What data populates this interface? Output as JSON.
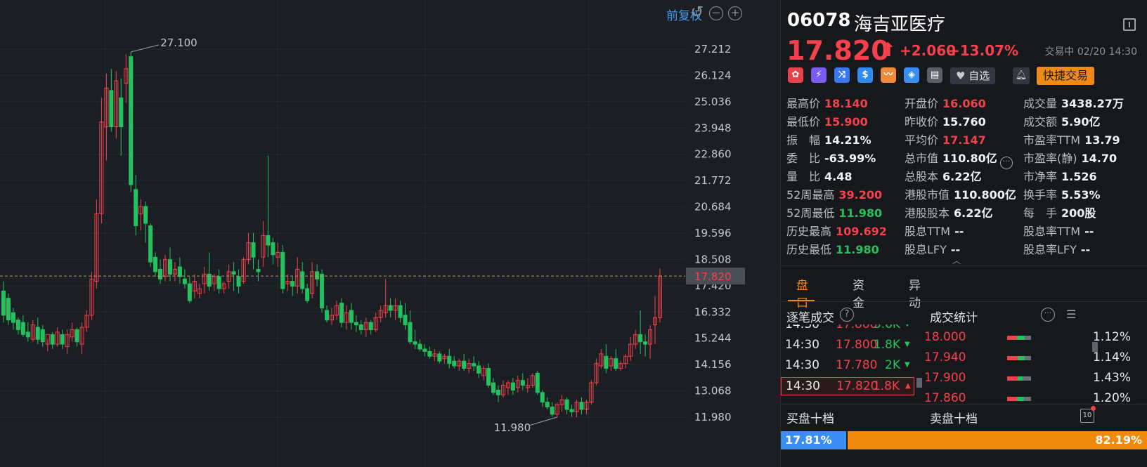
{
  "chart_toolbar": {
    "restore_label": "前复权",
    "reset_icon": "reset-icon",
    "zoom_out_icon": "zoom-out-icon",
    "zoom_in_icon": "zoom-in-icon"
  },
  "chart_data": {
    "type": "candlestick",
    "y_ticks": [
      "27.212",
      "26.124",
      "25.036",
      "23.948",
      "22.860",
      "21.772",
      "20.684",
      "19.596",
      "18.508",
      "17.420",
      "16.332",
      "15.244",
      "14.156",
      "13.068",
      "11.980"
    ],
    "ylim": [
      11.98,
      27.212
    ],
    "current_price_label": "17.820",
    "max_annotation": "27.100",
    "min_annotation": "11.980",
    "up_color": "#f5414b",
    "down_color": "#22c35f",
    "candles": [
      {
        "o": 17.2,
        "h": 17.6,
        "c": 16.2,
        "l": 15.9
      },
      {
        "o": 16.9,
        "h": 17.1,
        "c": 16.0,
        "l": 15.8
      },
      {
        "o": 16.3,
        "h": 16.5,
        "c": 15.9,
        "l": 15.6
      },
      {
        "o": 16.0,
        "h": 16.1,
        "c": 15.6,
        "l": 15.4
      },
      {
        "o": 15.9,
        "h": 16.2,
        "c": 15.4,
        "l": 15.3
      },
      {
        "o": 15.5,
        "h": 15.9,
        "c": 15.3,
        "l": 15.1
      },
      {
        "o": 15.2,
        "h": 16.0,
        "c": 15.8,
        "l": 15.1
      },
      {
        "o": 15.7,
        "h": 16.1,
        "c": 15.2,
        "l": 15.0
      },
      {
        "o": 15.6,
        "h": 15.8,
        "c": 15.1,
        "l": 14.9
      },
      {
        "o": 15.0,
        "h": 15.2,
        "c": 15.4,
        "l": 14.7
      },
      {
        "o": 15.4,
        "h": 15.5,
        "c": 15.0,
        "l": 14.8
      },
      {
        "o": 15.0,
        "h": 15.7,
        "c": 15.5,
        "l": 14.9
      },
      {
        "o": 15.4,
        "h": 15.6,
        "c": 15.0,
        "l": 14.8
      },
      {
        "o": 14.9,
        "h": 15.6,
        "c": 15.4,
        "l": 14.6
      },
      {
        "o": 15.3,
        "h": 15.9,
        "c": 15.6,
        "l": 15.1
      },
      {
        "o": 15.6,
        "h": 15.7,
        "c": 15.1,
        "l": 14.9
      },
      {
        "o": 15.0,
        "h": 15.9,
        "c": 15.7,
        "l": 14.6
      },
      {
        "o": 15.7,
        "h": 16.4,
        "c": 16.2,
        "l": 15.5
      },
      {
        "o": 16.2,
        "h": 18.0,
        "c": 17.7,
        "l": 16.0
      },
      {
        "o": 17.6,
        "h": 21.0,
        "c": 20.4,
        "l": 17.3
      },
      {
        "o": 20.4,
        "h": 25.2,
        "c": 24.2,
        "l": 20.0
      },
      {
        "o": 24.0,
        "h": 26.2,
        "c": 25.6,
        "l": 22.6
      },
      {
        "o": 25.5,
        "h": 26.4,
        "c": 24.0,
        "l": 23.8
      },
      {
        "o": 24.0,
        "h": 26.3,
        "c": 25.9,
        "l": 23.5
      },
      {
        "o": 25.2,
        "h": 26.0,
        "c": 24.0,
        "l": 22.8
      },
      {
        "o": 25.8,
        "h": 27.0,
        "c": 26.4,
        "l": 25.0
      },
      {
        "o": 26.9,
        "h": 27.1,
        "c": 21.6,
        "l": 21.3
      },
      {
        "o": 21.4,
        "h": 22.0,
        "c": 19.9,
        "l": 19.5
      },
      {
        "o": 20.4,
        "h": 21.0,
        "c": 20.7,
        "l": 19.7
      },
      {
        "o": 20.7,
        "h": 20.9,
        "c": 20.0,
        "l": 19.2
      },
      {
        "o": 19.9,
        "h": 20.0,
        "c": 18.4,
        "l": 18.2
      },
      {
        "o": 18.6,
        "h": 18.8,
        "c": 18.0,
        "l": 17.8
      },
      {
        "o": 18.1,
        "h": 18.5,
        "c": 17.7,
        "l": 17.5
      },
      {
        "o": 17.8,
        "h": 18.7,
        "c": 18.5,
        "l": 17.6
      },
      {
        "o": 18.5,
        "h": 19.0,
        "c": 17.9,
        "l": 17.6
      },
      {
        "o": 17.9,
        "h": 18.4,
        "c": 18.1,
        "l": 17.6
      },
      {
        "o": 18.2,
        "h": 18.6,
        "c": 17.8,
        "l": 17.5
      },
      {
        "o": 17.7,
        "h": 18.1,
        "c": 17.5,
        "l": 17.3
      },
      {
        "o": 17.5,
        "h": 17.8,
        "c": 16.8,
        "l": 16.7
      },
      {
        "o": 17.2,
        "h": 17.9,
        "c": 17.6,
        "l": 16.9
      },
      {
        "o": 17.1,
        "h": 17.5,
        "c": 17.3,
        "l": 16.9
      },
      {
        "o": 17.5,
        "h": 18.2,
        "c": 17.9,
        "l": 17.1
      },
      {
        "o": 17.9,
        "h": 18.8,
        "c": 17.4,
        "l": 17.2
      },
      {
        "o": 17.5,
        "h": 17.9,
        "c": 17.8,
        "l": 17.2
      },
      {
        "o": 17.8,
        "h": 18.1,
        "c": 17.3,
        "l": 17.1
      },
      {
        "o": 17.3,
        "h": 17.6,
        "c": 17.5,
        "l": 17.1
      },
      {
        "o": 17.6,
        "h": 18.3,
        "c": 18.0,
        "l": 17.3
      },
      {
        "o": 18.0,
        "h": 18.4,
        "c": 17.9,
        "l": 17.2
      },
      {
        "o": 17.8,
        "h": 18.1,
        "c": 17.4,
        "l": 17.1
      },
      {
        "o": 17.6,
        "h": 18.6,
        "c": 18.5,
        "l": 17.5
      },
      {
        "o": 18.5,
        "h": 19.6,
        "c": 19.2,
        "l": 18.3
      },
      {
        "o": 19.2,
        "h": 19.6,
        "c": 18.6,
        "l": 18.1
      },
      {
        "o": 18.1,
        "h": 18.5,
        "c": 18.0,
        "l": 17.6
      },
      {
        "o": 18.6,
        "h": 20.1,
        "c": 19.5,
        "l": 18.2
      },
      {
        "o": 19.5,
        "h": 22.8,
        "c": 19.1,
        "l": 18.6
      },
      {
        "o": 19.2,
        "h": 19.4,
        "c": 18.7,
        "l": 18.3
      },
      {
        "o": 18.6,
        "h": 19.2,
        "c": 18.8,
        "l": 18.2
      },
      {
        "o": 18.8,
        "h": 19.1,
        "c": 17.3,
        "l": 17.1
      },
      {
        "o": 17.5,
        "h": 17.9,
        "c": 17.6,
        "l": 17.2
      },
      {
        "o": 17.6,
        "h": 17.8,
        "c": 17.4,
        "l": 17.0
      },
      {
        "o": 17.4,
        "h": 18.6,
        "c": 18.1,
        "l": 17.1
      },
      {
        "o": 18.0,
        "h": 18.4,
        "c": 17.3,
        "l": 17.1
      },
      {
        "o": 17.3,
        "h": 17.5,
        "c": 16.8,
        "l": 16.7
      },
      {
        "o": 17.1,
        "h": 18.4,
        "c": 18.0,
        "l": 16.9
      },
      {
        "o": 18.0,
        "h": 18.3,
        "c": 17.7,
        "l": 17.4
      },
      {
        "o": 17.9,
        "h": 18.1,
        "c": 16.5,
        "l": 16.3
      },
      {
        "o": 16.4,
        "h": 16.6,
        "c": 16.0,
        "l": 15.9
      },
      {
        "o": 16.0,
        "h": 16.5,
        "c": 16.2,
        "l": 15.8
      },
      {
        "o": 16.2,
        "h": 16.8,
        "c": 16.6,
        "l": 16.0
      },
      {
        "o": 16.7,
        "h": 16.9,
        "c": 15.9,
        "l": 15.7
      },
      {
        "o": 15.9,
        "h": 16.6,
        "c": 16.3,
        "l": 15.6
      },
      {
        "o": 16.4,
        "h": 16.7,
        "c": 15.9,
        "l": 15.6
      },
      {
        "o": 15.9,
        "h": 16.2,
        "c": 15.8,
        "l": 15.5
      },
      {
        "o": 15.8,
        "h": 16.0,
        "c": 15.6,
        "l": 15.4
      },
      {
        "o": 15.6,
        "h": 16.1,
        "c": 15.9,
        "l": 15.3
      },
      {
        "o": 15.9,
        "h": 16.0,
        "c": 15.6,
        "l": 15.4
      },
      {
        "o": 15.6,
        "h": 16.3,
        "c": 16.1,
        "l": 15.5
      },
      {
        "o": 16.1,
        "h": 16.6,
        "c": 16.4,
        "l": 15.9
      },
      {
        "o": 16.3,
        "h": 17.7,
        "c": 16.6,
        "l": 16.1
      },
      {
        "o": 16.6,
        "h": 16.9,
        "c": 16.4,
        "l": 16.1
      },
      {
        "o": 16.4,
        "h": 16.9,
        "c": 16.6,
        "l": 16.0
      },
      {
        "o": 16.6,
        "h": 16.8,
        "c": 16.1,
        "l": 15.9
      },
      {
        "o": 16.2,
        "h": 16.7,
        "c": 15.8,
        "l": 15.6
      },
      {
        "o": 15.9,
        "h": 16.4,
        "c": 15.1,
        "l": 15.0
      },
      {
        "o": 15.1,
        "h": 15.6,
        "c": 15.0,
        "l": 14.8
      },
      {
        "o": 15.0,
        "h": 15.2,
        "c": 14.8,
        "l": 14.7
      },
      {
        "o": 14.8,
        "h": 15.0,
        "c": 14.7,
        "l": 14.5
      },
      {
        "o": 14.7,
        "h": 14.9,
        "c": 14.5,
        "l": 14.4
      },
      {
        "o": 14.5,
        "h": 14.8,
        "c": 14.6,
        "l": 14.3
      },
      {
        "o": 14.6,
        "h": 14.7,
        "c": 14.3,
        "l": 14.2
      },
      {
        "o": 14.4,
        "h": 14.6,
        "c": 14.5,
        "l": 14.2
      },
      {
        "o": 14.5,
        "h": 14.8,
        "c": 14.2,
        "l": 14.0
      },
      {
        "o": 14.3,
        "h": 14.5,
        "c": 14.1,
        "l": 14.0
      },
      {
        "o": 14.1,
        "h": 14.4,
        "c": 14.3,
        "l": 13.9
      },
      {
        "o": 14.3,
        "h": 14.6,
        "c": 14.0,
        "l": 13.9
      },
      {
        "o": 14.0,
        "h": 14.4,
        "c": 14.2,
        "l": 13.8
      },
      {
        "o": 14.2,
        "h": 14.5,
        "c": 14.1,
        "l": 13.9
      },
      {
        "o": 14.1,
        "h": 14.3,
        "c": 13.8,
        "l": 13.6
      },
      {
        "o": 13.7,
        "h": 14.1,
        "c": 14.0,
        "l": 13.5
      },
      {
        "o": 14.0,
        "h": 14.2,
        "c": 13.3,
        "l": 13.2
      },
      {
        "o": 13.4,
        "h": 13.6,
        "c": 13.0,
        "l": 12.9
      },
      {
        "o": 13.1,
        "h": 13.3,
        "c": 12.9,
        "l": 12.6
      },
      {
        "o": 12.9,
        "h": 13.5,
        "c": 13.3,
        "l": 12.8
      },
      {
        "o": 13.2,
        "h": 13.5,
        "c": 13.4,
        "l": 12.9
      },
      {
        "o": 13.4,
        "h": 13.6,
        "c": 13.1,
        "l": 12.9
      },
      {
        "o": 13.2,
        "h": 13.7,
        "c": 13.5,
        "l": 13.0
      },
      {
        "o": 13.5,
        "h": 13.8,
        "c": 13.3,
        "l": 13.1
      },
      {
        "o": 13.2,
        "h": 13.6,
        "c": 13.3,
        "l": 13.0
      },
      {
        "o": 13.3,
        "h": 13.8,
        "c": 13.7,
        "l": 13.2
      },
      {
        "o": 13.8,
        "h": 13.9,
        "c": 13.0,
        "l": 12.9
      },
      {
        "o": 13.0,
        "h": 13.1,
        "c": 12.6,
        "l": 12.4
      },
      {
        "o": 12.6,
        "h": 12.8,
        "c": 12.4,
        "l": 12.3
      },
      {
        "o": 12.4,
        "h": 12.6,
        "c": 12.1,
        "l": 12.0
      },
      {
        "o": 12.1,
        "h": 12.6,
        "c": 12.5,
        "l": 11.98
      },
      {
        "o": 12.5,
        "h": 12.9,
        "c": 12.7,
        "l": 12.2
      },
      {
        "o": 12.7,
        "h": 12.8,
        "c": 12.3,
        "l": 12.1
      },
      {
        "o": 12.3,
        "h": 12.5,
        "c": 12.2,
        "l": 12.0
      },
      {
        "o": 12.2,
        "h": 12.7,
        "c": 12.6,
        "l": 11.98
      },
      {
        "o": 12.6,
        "h": 12.8,
        "c": 12.3,
        "l": 12.1
      },
      {
        "o": 12.3,
        "h": 12.7,
        "c": 12.6,
        "l": 12.1
      },
      {
        "o": 12.6,
        "h": 13.5,
        "c": 13.4,
        "l": 12.5
      },
      {
        "o": 13.4,
        "h": 14.4,
        "c": 14.2,
        "l": 13.3
      },
      {
        "o": 14.1,
        "h": 14.8,
        "c": 14.6,
        "l": 14.0
      },
      {
        "o": 14.5,
        "h": 15.0,
        "c": 14.0,
        "l": 13.8
      },
      {
        "o": 14.1,
        "h": 14.5,
        "c": 14.4,
        "l": 13.9
      },
      {
        "o": 14.4,
        "h": 14.8,
        "c": 14.0,
        "l": 13.9
      },
      {
        "o": 14.0,
        "h": 14.3,
        "c": 14.2,
        "l": 13.9
      },
      {
        "o": 14.2,
        "h": 14.6,
        "c": 14.5,
        "l": 14.0
      },
      {
        "o": 14.5,
        "h": 15.3,
        "c": 15.0,
        "l": 14.3
      },
      {
        "o": 15.0,
        "h": 15.6,
        "c": 15.4,
        "l": 14.8
      },
      {
        "o": 15.4,
        "h": 16.4,
        "c": 15.1,
        "l": 14.6
      },
      {
        "o": 15.1,
        "h": 15.4,
        "c": 15.0,
        "l": 14.5
      },
      {
        "o": 15.0,
        "h": 15.8,
        "c": 15.6,
        "l": 14.4
      },
      {
        "o": 15.8,
        "h": 17.0,
        "c": 16.1,
        "l": 15.0
      },
      {
        "o": 16.1,
        "h": 18.14,
        "c": 17.82,
        "l": 15.9
      }
    ]
  },
  "quote": {
    "code": "06078",
    "name": "海吉亚医疗",
    "price": "17.820",
    "arrow": "⬆",
    "change": "+2.060",
    "change_pct": "+13.07%",
    "market_status": "交易中 02/20 14:30",
    "fav_label": "自选",
    "quick_trade_label": "快捷交易"
  },
  "tags": [
    {
      "icon": "hk-flag-icon",
      "glyph": "✿",
      "color": "#e8424a"
    },
    {
      "icon": "margin-icon",
      "glyph": "⚡",
      "color": "#7b5cf0"
    },
    {
      "icon": "connect-icon",
      "glyph": "⤨",
      "color": "#3a78f0"
    },
    {
      "icon": "dollar-icon",
      "glyph": "$",
      "color": "#2e8cf0"
    },
    {
      "icon": "trend-icon",
      "glyph": "〰",
      "color": "#f08a3a"
    },
    {
      "icon": "price-tag-icon",
      "glyph": "◈",
      "color": "#3a8df2"
    },
    {
      "icon": "note-icon",
      "glyph": "▤",
      "color": "#5a5f67"
    }
  ],
  "stats": {
    "rows": [
      [
        {
          "l": "最高价",
          "v": "18.140",
          "c": "up"
        },
        {
          "l": "开盘价",
          "v": "16.060",
          "c": "up"
        },
        {
          "l": "成交量",
          "v": "3438.27万",
          "c": ""
        }
      ],
      [
        {
          "l": "最低价",
          "v": "15.900",
          "c": "up"
        },
        {
          "l": "昨收价",
          "v": "15.760",
          "c": ""
        },
        {
          "l": "成交额",
          "v": "5.90亿",
          "c": ""
        }
      ],
      [
        {
          "l": "振　幅",
          "v": "14.21%",
          "c": ""
        },
        {
          "l": "平均价",
          "v": "17.147",
          "c": "up"
        },
        {
          "l": "市盈率TTM",
          "v": "13.79",
          "c": ""
        }
      ],
      [
        {
          "l": "委　比",
          "v": "-63.99%",
          "c": ""
        },
        {
          "l": "总市值",
          "v": "110.80亿",
          "c": ""
        },
        {
          "l": "市盈率(静)",
          "v": "14.70",
          "c": ""
        }
      ],
      [
        {
          "l": "量　比",
          "v": "4.48",
          "c": ""
        },
        {
          "l": "总股本",
          "v": "6.22亿",
          "c": ""
        },
        {
          "l": "市净率",
          "v": "1.526",
          "c": ""
        }
      ],
      [
        {
          "l": "52周最高",
          "v": "39.200",
          "c": "up"
        },
        {
          "l": "港股市值",
          "v": "110.800亿",
          "c": ""
        },
        {
          "l": "换手率",
          "v": "5.53%",
          "c": ""
        }
      ],
      [
        {
          "l": "52周最低",
          "v": "11.980",
          "c": "dn"
        },
        {
          "l": "港股股本",
          "v": "6.22亿",
          "c": ""
        },
        {
          "l": "每　手",
          "v": "200股",
          "c": ""
        }
      ],
      [
        {
          "l": "历史最高",
          "v": "109.692",
          "c": "up"
        },
        {
          "l": "股息TTM",
          "v": "--",
          "c": ""
        },
        {
          "l": "股息率TTM",
          "v": "--",
          "c": ""
        }
      ],
      [
        {
          "l": "历史最低",
          "v": "11.980",
          "c": "dn"
        },
        {
          "l": "股息LFY",
          "v": "--",
          "c": ""
        },
        {
          "l": "股息率LFY",
          "v": "--",
          "c": ""
        }
      ]
    ]
  },
  "tabs": [
    "盘口",
    "资金",
    "异动"
  ],
  "ticks_title": "逐笔成交",
  "ticks": [
    {
      "t": "14:30",
      "p": "17.800",
      "v": "3.6K",
      "d": "dn"
    },
    {
      "t": "14:30",
      "p": "17.800",
      "v": "1.8K",
      "d": "dn"
    },
    {
      "t": "14:30",
      "p": "17.780",
      "v": "2K",
      "d": "dn"
    },
    {
      "t": "14:30",
      "p": "17.820",
      "v": "1.8K",
      "d": "up"
    }
  ],
  "volstats_title": "成交统计",
  "volstats": [
    {
      "p": "18.000",
      "pct": "1.12%",
      "red": 0.4,
      "green": 0.35
    },
    {
      "p": "17.940",
      "pct": "1.14%",
      "red": 0.45,
      "green": 0.3
    },
    {
      "p": "17.900",
      "pct": "1.43%",
      "red": 0.45,
      "green": 0.2
    },
    {
      "p": "17.860",
      "pct": "1.20%",
      "red": 0.4,
      "green": 0.3
    }
  ],
  "orderbook": {
    "buy_title": "买盘十档",
    "sell_title": "卖盘十档",
    "toggle_label": "10",
    "buy_pct": "17.81%",
    "sell_pct": "82.19%",
    "buy_ratio": 0.1781
  }
}
